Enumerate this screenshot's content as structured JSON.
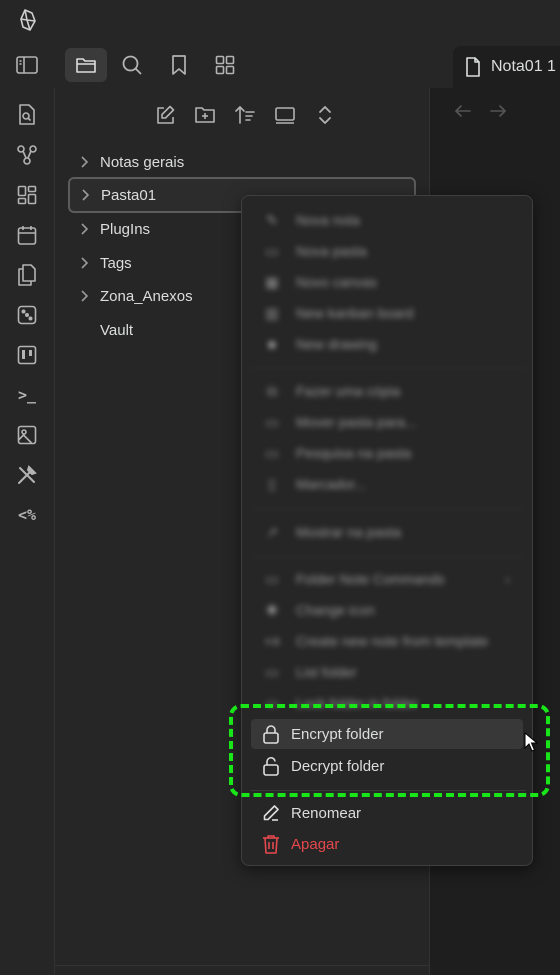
{
  "app": {
    "logo_icon": "obsidian-logo-icon"
  },
  "tabbar": {
    "icons": [
      "sidebar-toggle-icon",
      "folder-icon",
      "search-icon",
      "bookmark-icon",
      "grid-icon"
    ],
    "active_tab_label": "Nota01 1"
  },
  "ribbon": {
    "icons": [
      "file-search-icon",
      "graph-icon",
      "layout-icon",
      "calendar-icon",
      "copy-icon",
      "dice-icon",
      "kanban-icon",
      "terminal-icon",
      "image-icon",
      "tools-icon",
      "templater-icon"
    ],
    "terminal_glyph": ">_",
    "templater_glyph": "<%"
  },
  "explorer": {
    "toolbar_icons": [
      "new-note-icon",
      "new-folder-icon",
      "sort-icon",
      "collapse-icon",
      "expand-collapse-icon"
    ],
    "items": [
      {
        "label": "Notas gerais",
        "has_children": true,
        "selected": false
      },
      {
        "label": "Pasta01",
        "has_children": true,
        "selected": true
      },
      {
        "label": "PlugIns",
        "has_children": true,
        "selected": false
      },
      {
        "label": "Tags",
        "has_children": true,
        "selected": false
      },
      {
        "label": "Zona_Anexos",
        "has_children": true,
        "selected": false
      },
      {
        "label": "Vault",
        "has_children": false,
        "selected": false
      }
    ]
  },
  "context_menu": {
    "blurred_items": [
      "Nova nota",
      "Nova pasta",
      "Novo canvas",
      "New kanban board",
      "New drawing",
      "Fazer uma cópia",
      "Mover pasta para...",
      "Pesquisa na pasta",
      "Marcador...",
      "Mostrar na pasta",
      "Folder Note Commands",
      "Change icon",
      "Create new note from template",
      "List folder",
      "Lock folder in folder"
    ],
    "encrypt_label": "Encrypt folder",
    "decrypt_label": "Decrypt folder",
    "rename_label": "Renomear",
    "delete_label": "Apagar"
  },
  "colors": {
    "highlight": "#19e619",
    "danger": "#e5484d",
    "background": "#1e1e1e",
    "panel": "#262626"
  }
}
